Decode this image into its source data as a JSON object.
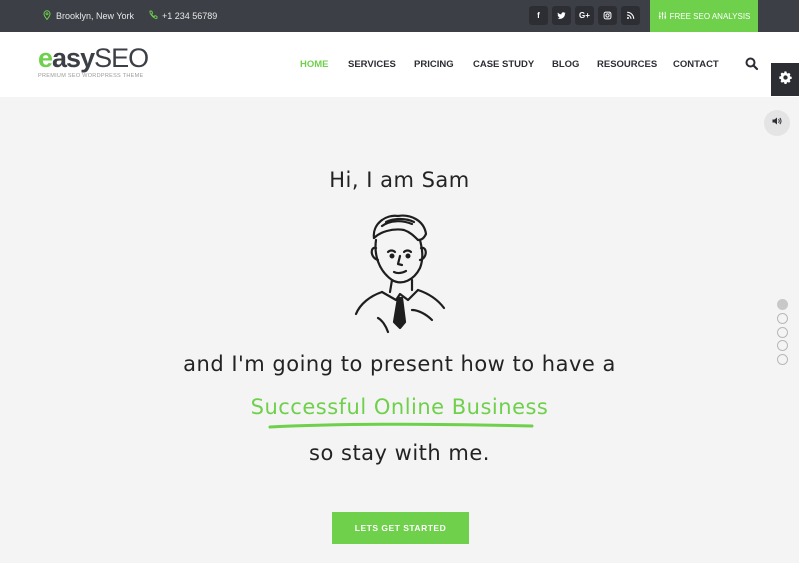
{
  "topbar": {
    "location": "Brooklyn, New York",
    "phone": "+1 234 56789",
    "socials": [
      {
        "icon": "facebook-icon",
        "glyph": "f"
      },
      {
        "icon": "twitter-icon",
        "glyph": "t"
      },
      {
        "icon": "google-plus-icon",
        "glyph": "G+"
      },
      {
        "icon": "instagram-icon",
        "glyph": ""
      },
      {
        "icon": "rss-icon",
        "glyph": ""
      }
    ],
    "cta_label": "FREE SEO ANALYSIS"
  },
  "brand": {
    "logo_e": "e",
    "logo_asy": "asy",
    "logo_seo": "SEO",
    "tagline": "PREMIUM SEO WORDPRESS THEME",
    "accent_color": "#6fd04b",
    "dark_color": "#3c3f46"
  },
  "nav": {
    "items": [
      {
        "label": "HOME",
        "active": true
      },
      {
        "label": "SERVICES",
        "active": false
      },
      {
        "label": "PRICING",
        "active": false
      },
      {
        "label": "CASE STUDY",
        "active": false
      },
      {
        "label": "BLOG",
        "active": false
      },
      {
        "label": "RESOURCES",
        "active": false
      },
      {
        "label": "CONTACT",
        "active": false
      }
    ]
  },
  "slider": {
    "slide_count": 5,
    "active_slide": 1
  },
  "hero": {
    "title": "Hi, I am Sam",
    "line1": "and I'm going to present how to have a",
    "highlight": "Successful Online Business",
    "line3": "so stay with me.",
    "cta_label": "LETS GET STARTED"
  }
}
